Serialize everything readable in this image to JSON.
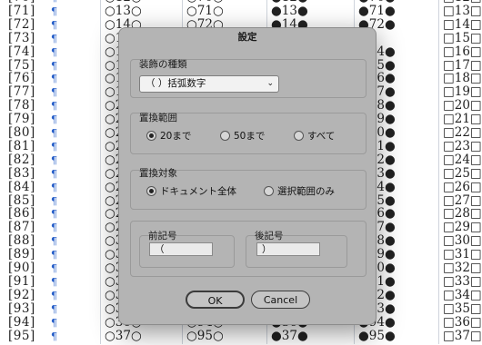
{
  "document": {
    "rows": [
      {
        "num": "[70]",
        "c1": "○12○",
        "c2": "○70○",
        "c3": "●12●",
        "c4": "●70●",
        "c5": "□12□"
      },
      {
        "num": "[71]",
        "c1": "○13○",
        "c2": "○71○",
        "c3": "●13●",
        "c4": "●71●",
        "c5": "□13□"
      },
      {
        "num": "[72]",
        "c1": "○14○",
        "c2": "○72○",
        "c3": "●14●",
        "c4": "●72●",
        "c5": "□14□"
      },
      {
        "num": "[73]",
        "c1": "○1",
        "c2": "○7",
        "c3": "●1",
        "c4": "●7",
        "c5": "□15□"
      },
      {
        "num": "[74]",
        "c1": "○1",
        "c2": "○7",
        "c3": "●1",
        "c4": "●74●",
        "c5": "□16□"
      },
      {
        "num": "[75]",
        "c1": "○1",
        "c2": "○7",
        "c3": "●1",
        "c4": "●75●",
        "c5": "□17□"
      },
      {
        "num": "[76]",
        "c1": "○1",
        "c2": "○7",
        "c3": "●1",
        "c4": "●76●",
        "c5": "□18□"
      },
      {
        "num": "[77]",
        "c1": "○1",
        "c2": "○7",
        "c3": "●1",
        "c4": "●77●",
        "c5": "□19□"
      },
      {
        "num": "[78]",
        "c1": "○2",
        "c2": "○7",
        "c3": "●2",
        "c4": "●78●",
        "c5": "□20□"
      },
      {
        "num": "[79]",
        "c1": "○2",
        "c2": "○7",
        "c3": "●2",
        "c4": "●79●",
        "c5": "□21□"
      },
      {
        "num": "[80]",
        "c1": "○2",
        "c2": "○8",
        "c3": "●2",
        "c4": "●80●",
        "c5": "□22□"
      },
      {
        "num": "[81]",
        "c1": "○2",
        "c2": "○8",
        "c3": "●2",
        "c4": "●81●",
        "c5": "□23□"
      },
      {
        "num": "[82]",
        "c1": "○2",
        "c2": "○8",
        "c3": "●2",
        "c4": "●82●",
        "c5": "□24□"
      },
      {
        "num": "[83]",
        "c1": "○2",
        "c2": "○8",
        "c3": "●2",
        "c4": "●83●",
        "c5": "□25□"
      },
      {
        "num": "[84]",
        "c1": "○2",
        "c2": "○8",
        "c3": "●2",
        "c4": "●84●",
        "c5": "□26□"
      },
      {
        "num": "[85]",
        "c1": "○2",
        "c2": "○8",
        "c3": "●2",
        "c4": "●85●",
        "c5": "□27□"
      },
      {
        "num": "[86]",
        "c1": "○2",
        "c2": "○8",
        "c3": "●2",
        "c4": "●86●",
        "c5": "□28□"
      },
      {
        "num": "[87]",
        "c1": "○2",
        "c2": "○8",
        "c3": "●2",
        "c4": "●87●",
        "c5": "□29□"
      },
      {
        "num": "[88]",
        "c1": "○3",
        "c2": "○8",
        "c3": "●3",
        "c4": "●88●",
        "c5": "□30□"
      },
      {
        "num": "[89]",
        "c1": "○3",
        "c2": "○8",
        "c3": "●3",
        "c4": "●89●",
        "c5": "□31□"
      },
      {
        "num": "[90]",
        "c1": "○3",
        "c2": "○9",
        "c3": "●3",
        "c4": "●90●",
        "c5": "□32□"
      },
      {
        "num": "[91]",
        "c1": "○3",
        "c2": "○9",
        "c3": "●3",
        "c4": "●91●",
        "c5": "□33□"
      },
      {
        "num": "[92]",
        "c1": "○3",
        "c2": "○9",
        "c3": "●3",
        "c4": "●92●",
        "c5": "□34□"
      },
      {
        "num": "[93]",
        "c1": "○3",
        "c2": "○9",
        "c3": "●3",
        "c4": "●93●",
        "c5": "□35□"
      },
      {
        "num": "[94]",
        "c1": "○36○",
        "c2": "○94○",
        "c3": "●36●",
        "c4": "●94●",
        "c5": "□36□"
      },
      {
        "num": "[95]",
        "c1": "○37○",
        "c2": "○95○",
        "c3": "●37●",
        "c4": "●95●",
        "c5": "□37□"
      }
    ],
    "pilcrow": "¶",
    "separator_color": "#cfd4dc",
    "pilcrow_color": "#2a61c9"
  },
  "dialog": {
    "title": "設定",
    "decoration": {
      "legend": "装飾の種類",
      "selected": "（ ）括弧数字",
      "chevron_icon": "chevron-down-icon"
    },
    "range": {
      "legend": "置換範囲",
      "options": [
        "20まで",
        "50まで",
        "すべて"
      ],
      "selected_index": 0
    },
    "target": {
      "legend": "置換対象",
      "options": [
        "ドキュメント全体",
        "選択範囲のみ"
      ],
      "selected_index": 0
    },
    "prefix": {
      "legend": "前記号",
      "value": "（"
    },
    "suffix": {
      "legend": "後記号",
      "value": "）"
    },
    "ok_label": "OK",
    "cancel_label": "Cancel"
  }
}
